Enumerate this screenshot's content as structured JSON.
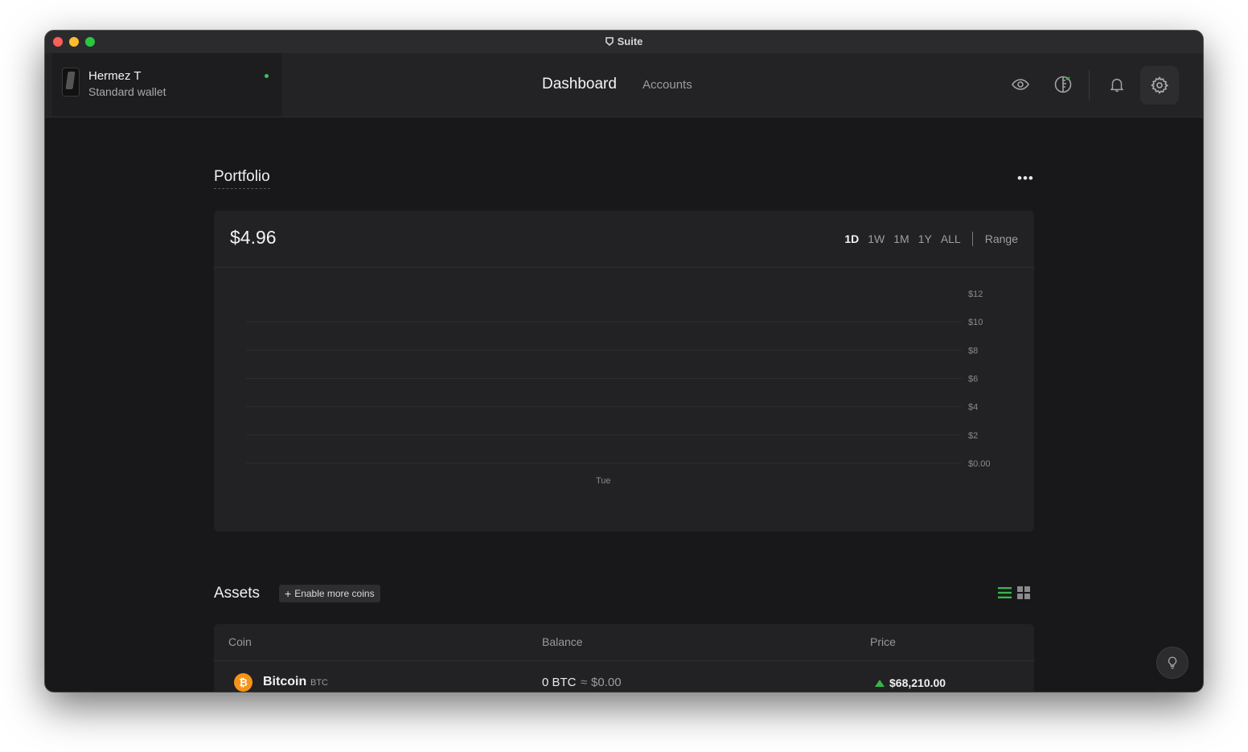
{
  "window": {
    "title": "Suite"
  },
  "device": {
    "name": "Hermez T",
    "wallet_type": "Standard wallet",
    "status_color": "#3ac25a"
  },
  "nav": {
    "dashboard": "Dashboard",
    "accounts": "Accounts"
  },
  "toolbar_icons": [
    "eye-icon",
    "discreet-mode-icon",
    "bell-icon",
    "gear-icon"
  ],
  "portfolio": {
    "title": "Portfolio",
    "more_label": "•••",
    "total": "$4.96",
    "ranges": [
      "1D",
      "1W",
      "1M",
      "1Y",
      "ALL"
    ],
    "active_range": "1D",
    "range_button": "Range"
  },
  "chart_data": {
    "type": "line",
    "title": "",
    "xlabel": "",
    "ylabel": "",
    "x_ticks": [
      "Tue"
    ],
    "y_ticks": [
      "$12",
      "$10",
      "$8",
      "$6",
      "$4",
      "$2",
      "$0.00"
    ],
    "ylim": [
      0,
      12
    ],
    "grid": true,
    "series": []
  },
  "assets": {
    "title": "Assets",
    "enable_button": "Enable more coins",
    "columns": [
      "Coin",
      "Balance",
      "Price"
    ],
    "rows": [
      {
        "name": "Bitcoin",
        "ticker": "BTC",
        "balance": "0 BTC",
        "approx": "≈",
        "fiat": "$0.00",
        "price": "$68,210.00",
        "trend": "up"
      }
    ]
  },
  "colors": {
    "accent": "#3ab44a",
    "bitcoin": "#f7931a",
    "background": "#18181a"
  }
}
